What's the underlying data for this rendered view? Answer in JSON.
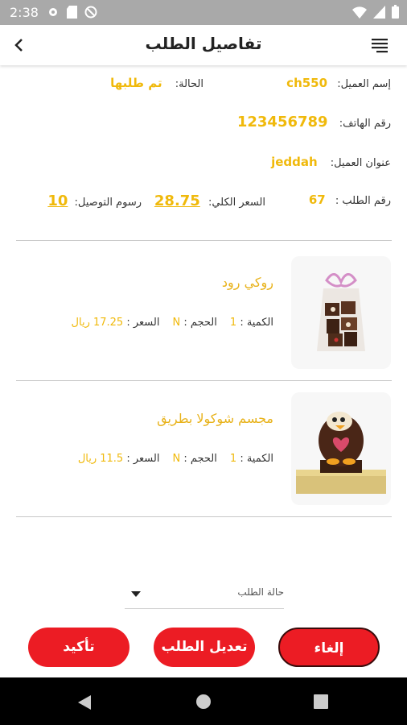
{
  "status_bar": {
    "time": "2:38"
  },
  "app_bar": {
    "title": "تفاصيل الطلب"
  },
  "order": {
    "customer_name_label": "إسم العميل:",
    "customer_name": "ch550",
    "status_label": "الحالة:",
    "status": "تم طلبها",
    "phone_label": "رقم الهاتف:",
    "phone": "123456789",
    "address_label": "عنوان العميل:",
    "address": "jeddah",
    "order_number_label": "رقم الطلب :",
    "order_number": "67",
    "total_label": "السعر الكلي:",
    "total": "28.75",
    "delivery_label": "رسوم التوصيل:",
    "delivery": "10"
  },
  "products": [
    {
      "name": "روكي رود",
      "qty_label": "الكمية :",
      "qty": "1",
      "size_label": "الحجم :",
      "size": "N",
      "price_label": "السعر :",
      "price": "17.25 ريال"
    },
    {
      "name": "مجسم شوكولا بطريق",
      "qty_label": "الكمية :",
      "qty": "1",
      "size_label": "الحجم :",
      "size": "N",
      "price_label": "السعر :",
      "price": "11.5 ريال"
    }
  ],
  "order_status_select": {
    "label": "حالة الطلب"
  },
  "buttons": {
    "cancel": "إلغاء",
    "edit": "تعديل الطلب",
    "confirm": "تأكيد"
  },
  "colors": {
    "accent": "#f0b90b",
    "button": "#ec1c24",
    "status_bar": "#a9a9a9"
  }
}
